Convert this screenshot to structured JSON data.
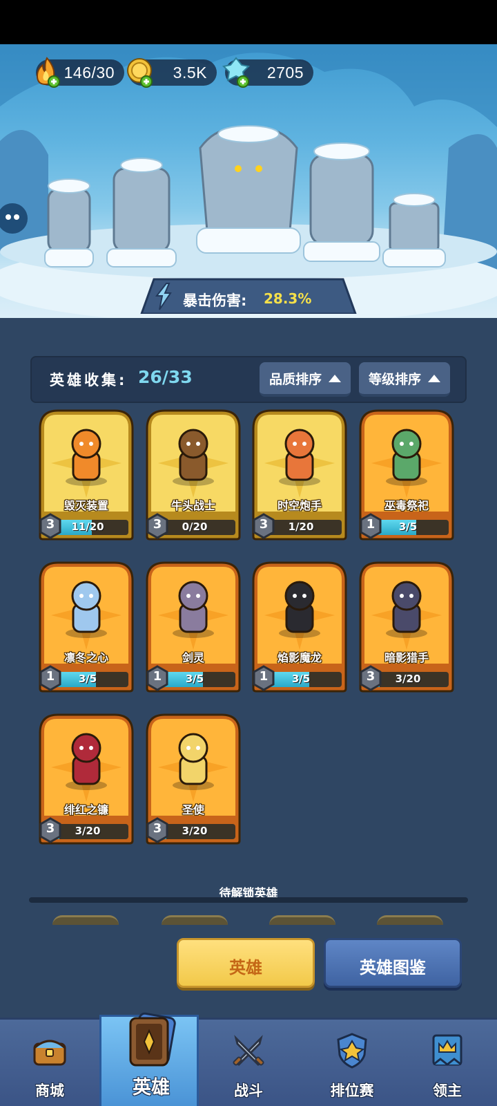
{
  "resources": {
    "energy": {
      "value": "146/30",
      "icon": "fire-icon"
    },
    "coins": {
      "value": "3.5K",
      "icon": "coin-icon"
    },
    "gems": {
      "value": "2705",
      "icon": "crystal-icon"
    }
  },
  "banner": {
    "crit_label": "暴击伤害:",
    "crit_value": "28.3%"
  },
  "collection": {
    "label": "英雄收集:",
    "value": "26/33",
    "sort_quality": "品质排序",
    "sort_level": "等级排序"
  },
  "heroes": [
    {
      "name": "毁灭装置",
      "stars": "3",
      "progress": "11/20",
      "fill": 0.55,
      "rarity": "gold"
    },
    {
      "name": "牛头战士",
      "stars": "3",
      "progress": "0/20",
      "fill": 0.0,
      "rarity": "gold"
    },
    {
      "name": "时空炮手",
      "stars": "3",
      "progress": "1/20",
      "fill": 0.05,
      "rarity": "gold"
    },
    {
      "name": "巫毒祭祀",
      "stars": "1",
      "progress": "3/5",
      "fill": 0.6,
      "rarity": "orange"
    },
    {
      "name": "凛冬之心",
      "stars": "1",
      "progress": "3/5",
      "fill": 0.6,
      "rarity": "orange"
    },
    {
      "name": "剑灵",
      "stars": "1",
      "progress": "3/5",
      "fill": 0.6,
      "rarity": "orange"
    },
    {
      "name": "焰影魔龙",
      "stars": "1",
      "progress": "3/5",
      "fill": 0.6,
      "rarity": "orange"
    },
    {
      "name": "暗影猎手",
      "stars": "3",
      "progress": "3/20",
      "fill": 0.15,
      "rarity": "orange"
    },
    {
      "name": "绯红之镰",
      "stars": "3",
      "progress": "3/20",
      "fill": 0.15,
      "rarity": "orange"
    },
    {
      "name": "圣使",
      "stars": "3",
      "progress": "3/20",
      "fill": 0.15,
      "rarity": "orange"
    }
  ],
  "locked": {
    "title": "待解锁英雄"
  },
  "actions": {
    "hero": "英雄",
    "codex": "英雄图鉴"
  },
  "nav": {
    "shop": "商城",
    "hero": "英雄",
    "battle": "战斗",
    "ranked": "排位赛",
    "lord": "领主"
  },
  "colors": {
    "panel": "#2f4663",
    "progress_fill": "#2aa9c8",
    "crit_value": "#f5e04a",
    "collect_value": "#7fd8ef"
  }
}
